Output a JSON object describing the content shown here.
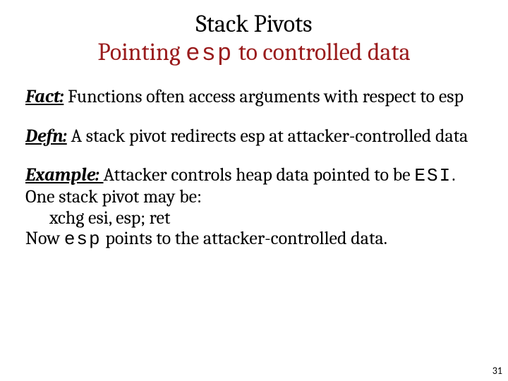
{
  "title": {
    "line1": "Stack Pivots",
    "line2_pre": "Pointing ",
    "line2_code": "esp",
    "line2_post": " to controlled data"
  },
  "fact": {
    "lead": "Fact:",
    "text": " Functions often access arguments with respect to esp"
  },
  "defn": {
    "lead": "Defn:",
    "text": " A stack pivot redirects esp at attacker-controlled data"
  },
  "example": {
    "lead": "Example: ",
    "l1_pre": "Attacker controls heap data pointed to be ",
    "l1_code": "ESI",
    "l1_post": ". One stack pivot may be:",
    "l2": "xchg esi, esp; ret",
    "l3_pre": "Now ",
    "l3_code": "esp",
    "l3_post": " points to the attacker-controlled data."
  },
  "page_number": "31"
}
